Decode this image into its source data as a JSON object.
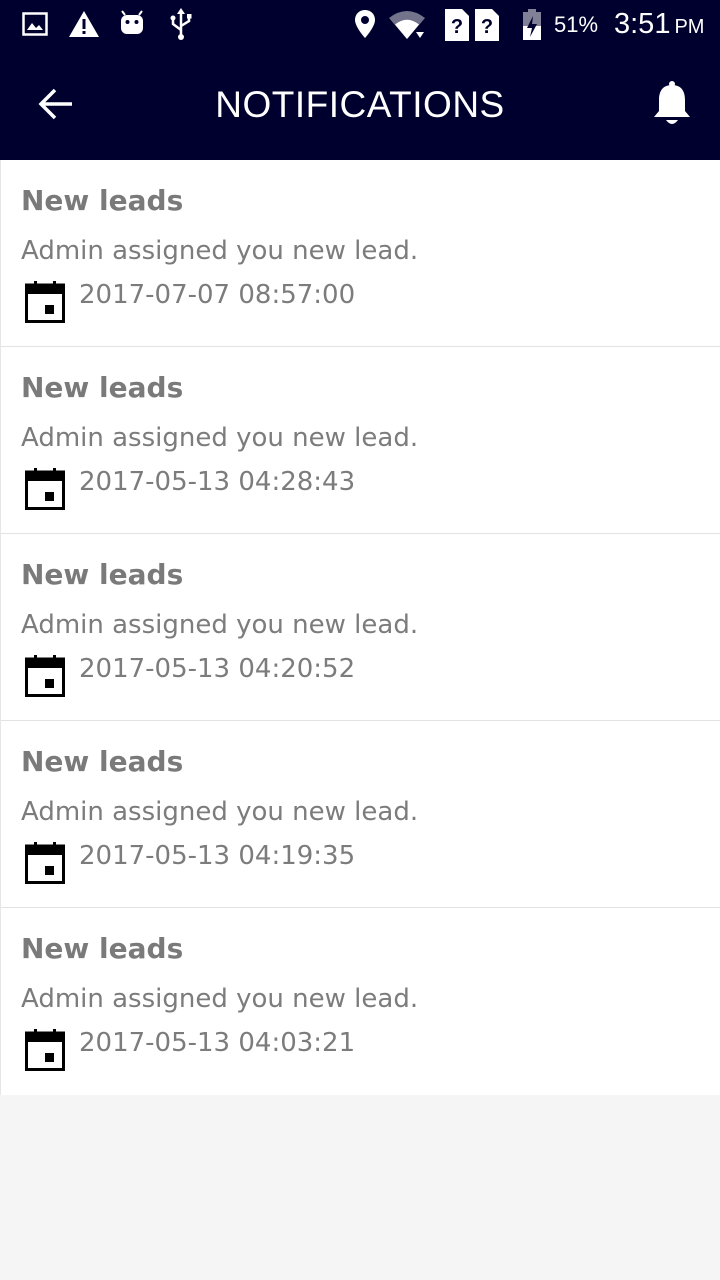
{
  "status_bar": {
    "battery_percent": "51%",
    "time": "3:51",
    "ampm": "PM",
    "icons": [
      "image-icon",
      "warning-icon",
      "android-icon",
      "usb-icon",
      "location-icon",
      "wifi-icon",
      "sim-unknown-icon",
      "sim-unknown-icon",
      "battery-charging-icon"
    ]
  },
  "app_bar": {
    "title": "NOTIFICATIONS",
    "back_icon": "arrow-back-icon",
    "bell_icon": "bell-icon",
    "background": "#00002e"
  },
  "notifications": [
    {
      "title": "New leads",
      "message": "Admin assigned you new lead.",
      "date": "2017-07-07 08:57:00"
    },
    {
      "title": "New leads",
      "message": "Admin assigned you new lead.",
      "date": "2017-05-13 04:28:43"
    },
    {
      "title": "New leads",
      "message": "Admin assigned you new lead.",
      "date": "2017-05-13 04:20:52"
    },
    {
      "title": "New leads",
      "message": "Admin assigned you new lead.",
      "date": "2017-05-13 04:19:35"
    },
    {
      "title": "New leads",
      "message": "Admin assigned you new lead.",
      "date": "2017-05-13 04:03:21"
    }
  ]
}
